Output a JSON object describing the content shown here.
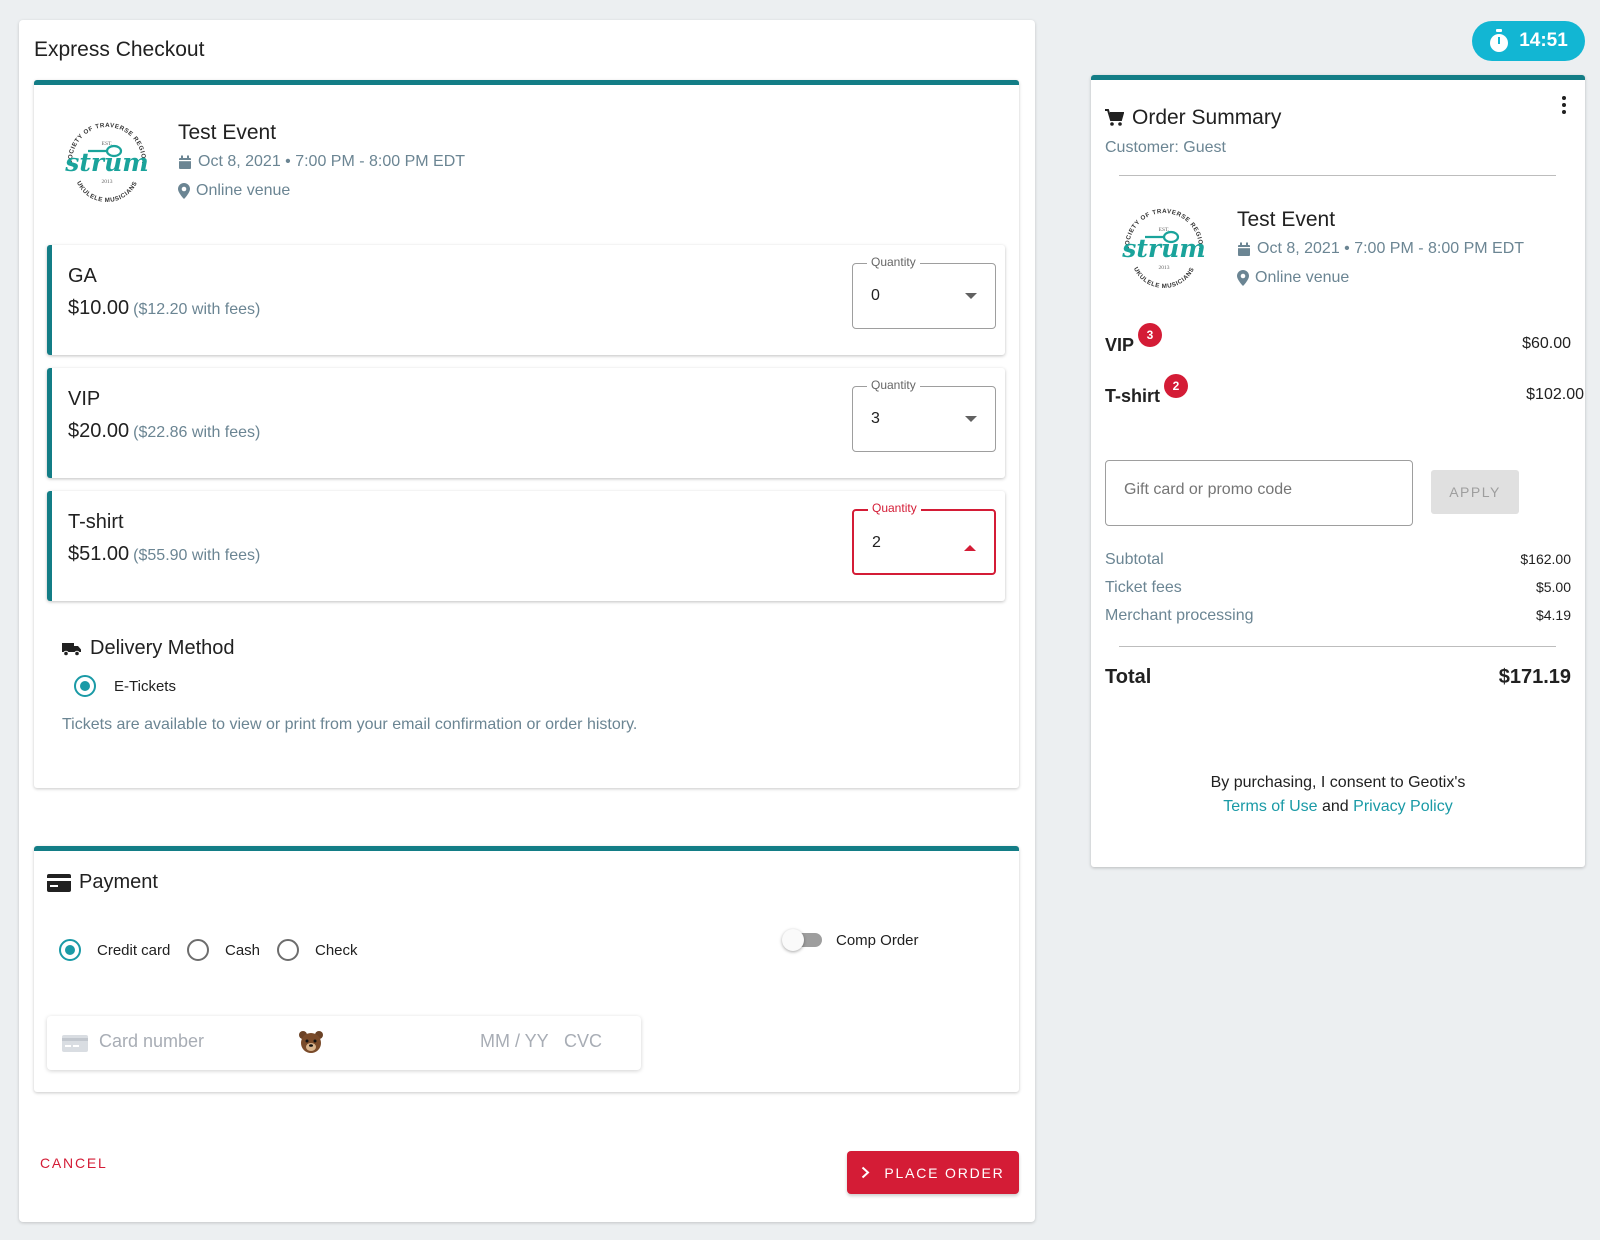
{
  "timer": {
    "value": "14:51",
    "icon": "stopwatch-icon"
  },
  "checkout": {
    "title": "Express Checkout",
    "event": {
      "title": "Test Event",
      "date": "Oct 8, 2021 • 7:00 PM - 8:00 PM EDT",
      "venue": "Online venue",
      "logo_text": "strum",
      "logo_ring_top": "SOCIETY OF TRAVERSE REGION",
      "logo_ring_bottom": "UKULELE MUSICIANS",
      "logo_est": "EST.",
      "logo_year": "2013"
    },
    "tickets": [
      {
        "name": "GA",
        "price": "$10.00",
        "fees": "($12.20 with fees)",
        "quantity_label": "Quantity",
        "quantity": "0"
      },
      {
        "name": "VIP",
        "price": "$20.00",
        "fees": "($22.86 with fees)",
        "quantity_label": "Quantity",
        "quantity": "3"
      },
      {
        "name": "T-shirt",
        "price": "$51.00",
        "fees": "($55.90 with fees)",
        "quantity_label": "Quantity",
        "quantity": "2"
      }
    ],
    "delivery": {
      "title": "Delivery Method",
      "option": "E-Tickets",
      "note": "Tickets are available to view or print from your email confirmation or order history."
    },
    "payment": {
      "title": "Payment",
      "methods": [
        "Credit card",
        "Cash",
        "Check"
      ],
      "selected": "Credit card",
      "comp_order_label": "Comp Order",
      "comp_order_on": false,
      "card_placeholder": "Card number",
      "expiry_placeholder": "MM / YY",
      "cvc_placeholder": "CVC"
    },
    "cancel_label": "CANCEL",
    "place_order_label": "PLACE ORDER"
  },
  "summary": {
    "title": "Order Summary",
    "customer": "Customer: Guest",
    "event": {
      "title": "Test Event",
      "date": "Oct 8, 2021 • 7:00 PM - 8:00 PM EDT",
      "venue": "Online venue"
    },
    "items": [
      {
        "name": "VIP",
        "count": "3",
        "amount": "$60.00"
      },
      {
        "name": "T-shirt",
        "count": "2",
        "amount": "$102.00"
      }
    ],
    "promo_placeholder": "Gift card or promo code",
    "apply_label": "APPLY",
    "subtotal_label": "Subtotal",
    "subtotal": "$162.00",
    "ticket_fees_label": "Ticket fees",
    "ticket_fees": "$5.00",
    "merchant_label": "Merchant processing",
    "merchant": "$4.19",
    "total_label": "Total",
    "total": "$171.19",
    "consent_text": "By purchasing, I consent to Geotix's",
    "terms_label": "Terms of Use",
    "and_label": "and",
    "privacy_label": "Privacy Policy"
  },
  "colors": {
    "accent": "#137d86",
    "teal_link": "#1a9aa6",
    "danger": "#d41c36",
    "timer": "#12b6d3",
    "muted": "#6b8593"
  }
}
